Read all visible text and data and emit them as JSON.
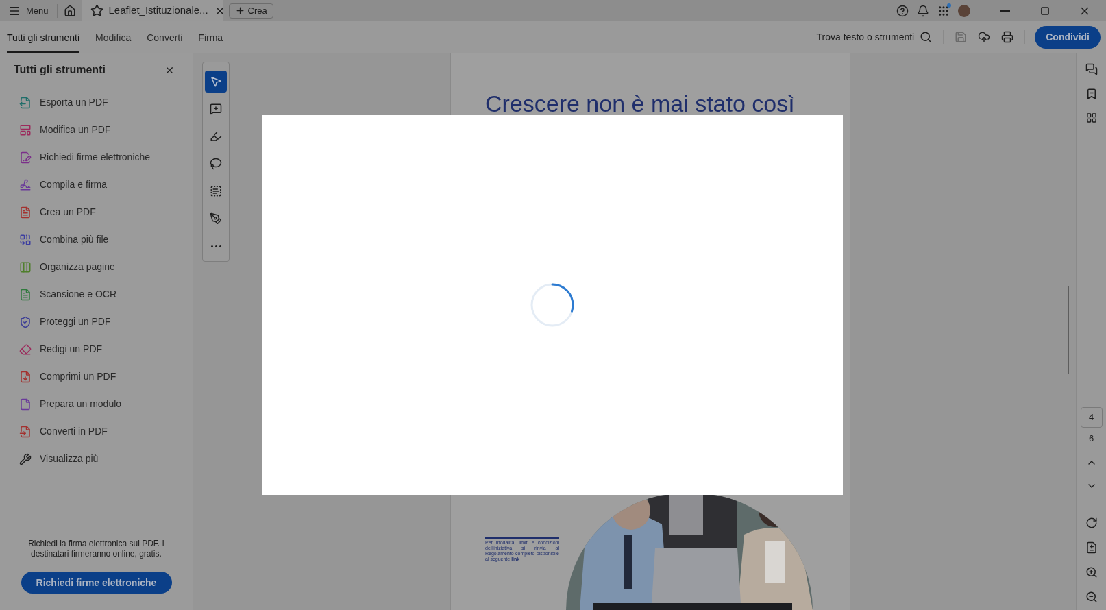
{
  "top_bar": {
    "menu": "Menu",
    "document_tab": {
      "title": "Leaflet_Istituzionale...",
      "selected": true
    },
    "create_button": "Crea",
    "apps_notification": true
  },
  "tabs": [
    {
      "label": "Tutti gli strumenti",
      "selected": true
    },
    {
      "label": "Modifica",
      "selected": false
    },
    {
      "label": "Converti",
      "selected": false
    },
    {
      "label": "Firma",
      "selected": false
    }
  ],
  "search": {
    "label": "Trova testo o strumenti"
  },
  "share_button": "Condividi",
  "sidebar": {
    "title": "Tutti gli strumenti",
    "items": [
      {
        "label": "Esporta un PDF",
        "color": "#1f6e6a"
      },
      {
        "label": "Modifica un PDF",
        "color": "#9c2a5c"
      },
      {
        "label": "Richiedi firme elettroniche",
        "color": "#7b2f8a"
      },
      {
        "label": "Compila e firma",
        "color": "#6a3a9a"
      },
      {
        "label": "Crea un PDF",
        "color": "#a3312f"
      },
      {
        "label": "Combina più file",
        "color": "#3d3fa0"
      },
      {
        "label": "Organizza pagine",
        "color": "#4f7f2b"
      },
      {
        "label": "Scansione e OCR",
        "color": "#2f7a3d"
      },
      {
        "label": "Proteggi un PDF",
        "color": "#3b3c96"
      },
      {
        "label": "Redigi un PDF",
        "color": "#9c2a5c"
      },
      {
        "label": "Comprimi un PDF",
        "color": "#a3312f"
      },
      {
        "label": "Prepara un modulo",
        "color": "#6a3a9a"
      },
      {
        "label": "Converti in PDF",
        "color": "#a3312f"
      },
      {
        "label": "Visualizza più",
        "color": "#1f1f1f"
      }
    ],
    "promo_text": "Richiedi la firma elettronica sui PDF. I destinatari firmeranno online, gratis.",
    "promo_button": "Richiedi firme elettroniche"
  },
  "tools": [
    {
      "kind": "select",
      "selected": true
    },
    {
      "kind": "comment",
      "selected": false
    },
    {
      "kind": "highlight",
      "selected": false
    },
    {
      "kind": "draw",
      "selected": false
    },
    {
      "kind": "text",
      "selected": false
    },
    {
      "kind": "sign",
      "selected": false
    },
    {
      "kind": "more",
      "selected": false
    }
  ],
  "document": {
    "heading": "Crescere non è mai stato così",
    "note": "Per modalità, limiti e condizioni dell'iniziativa si rinvia al Regolamento completo disponibile al seguente **link**"
  },
  "page_nav": {
    "current": "4",
    "total": "6"
  },
  "loading": {
    "level": 0.3
  }
}
